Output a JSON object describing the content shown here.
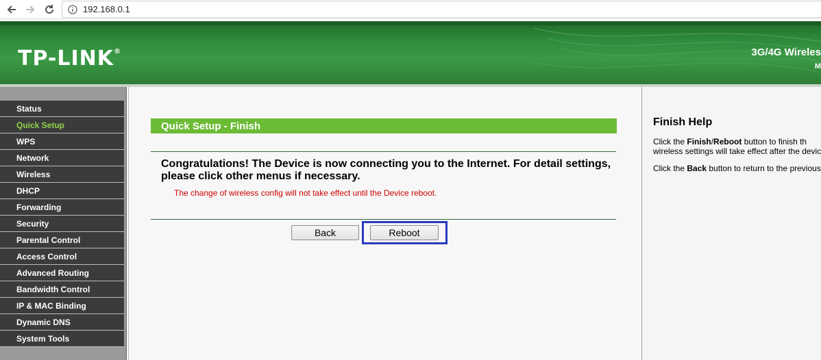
{
  "browser": {
    "url": "192.168.0.1"
  },
  "banner": {
    "logo_text": "TP-LINK",
    "model_text": "3G/4G Wireles",
    "model_sub": "M"
  },
  "sidebar": {
    "items": [
      {
        "label": "Status",
        "active": false
      },
      {
        "label": "Quick Setup",
        "active": true
      },
      {
        "label": "WPS",
        "active": false
      },
      {
        "label": "Network",
        "active": false
      },
      {
        "label": "Wireless",
        "active": false
      },
      {
        "label": "DHCP",
        "active": false
      },
      {
        "label": "Forwarding",
        "active": false
      },
      {
        "label": "Security",
        "active": false
      },
      {
        "label": "Parental Control",
        "active": false
      },
      {
        "label": "Access Control",
        "active": false
      },
      {
        "label": "Advanced Routing",
        "active": false
      },
      {
        "label": "Bandwidth Control",
        "active": false
      },
      {
        "label": "IP & MAC Binding",
        "active": false
      },
      {
        "label": "Dynamic DNS",
        "active": false
      },
      {
        "label": "System Tools",
        "active": false
      }
    ]
  },
  "main": {
    "title": "Quick Setup - Finish",
    "congrats": "Congratulations! The Device is now connecting you to the Internet. For detail settings, please click other menus if necessary.",
    "warning": "The change of wireless config will not take effect until the Device reboot.",
    "back_label": "Back",
    "reboot_label": "Reboot"
  },
  "help": {
    "title": "Finish Help",
    "p1_pre": "Click the ",
    "p1_b1": "Finish",
    "p1_slash": "/",
    "p1_b2": "Reboot",
    "p1_post": " button to finish th",
    "p1_line2": "wireless settings will take effect after the devic",
    "p2_pre": "Click the ",
    "p2_b": "Back",
    "p2_post": " button to return to the previous"
  },
  "colors": {
    "banner_green": "#2e8b3b",
    "title_green": "#6cbb35",
    "active_menu": "#8fd44a",
    "warning_red": "#cc0000",
    "highlight_blue": "#2a3bbf"
  }
}
